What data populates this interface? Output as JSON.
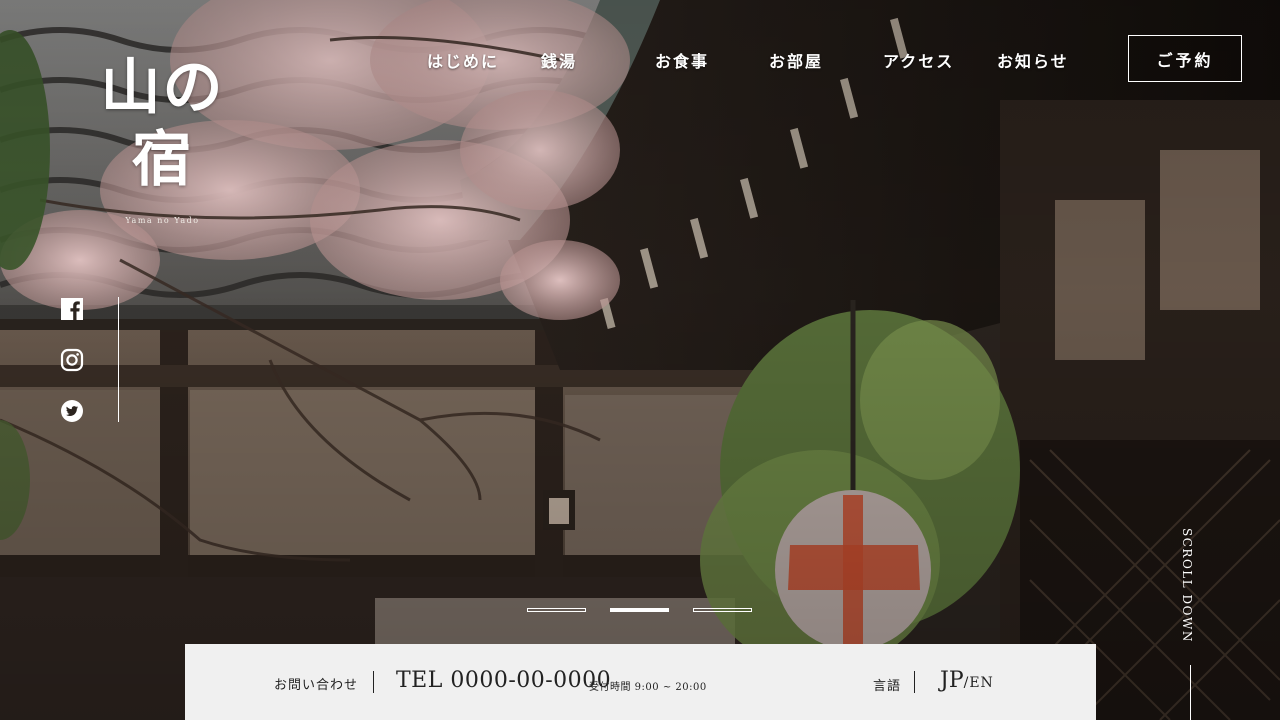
{
  "brand": {
    "name": "山の宿",
    "subtitle": "Yama no Yado"
  },
  "nav": {
    "items": [
      {
        "label": "はじめに"
      },
      {
        "label": "銭湯"
      },
      {
        "label": "お食事"
      },
      {
        "label": "お部屋"
      },
      {
        "label": "アクセス"
      },
      {
        "label": "お知らせ"
      }
    ],
    "reserve_label": "ご予約"
  },
  "social": {
    "icons": [
      "facebook-icon",
      "instagram-icon",
      "twitter-icon"
    ]
  },
  "slider": {
    "total": 3,
    "active_index": 1
  },
  "scroll_label": "SCROLL DOWN",
  "infobar": {
    "contact_label": "お問い合わせ",
    "tel": "TEL 0000-00-0000",
    "hours": "受付時間 9:00 ~ 20:00",
    "language_label": "言語",
    "lang_current": "JP",
    "lang_other": "/EN"
  },
  "colors": {
    "infobar_bg": "#f0f0f0",
    "text_dark": "#222222",
    "text_light": "#ffffff"
  }
}
